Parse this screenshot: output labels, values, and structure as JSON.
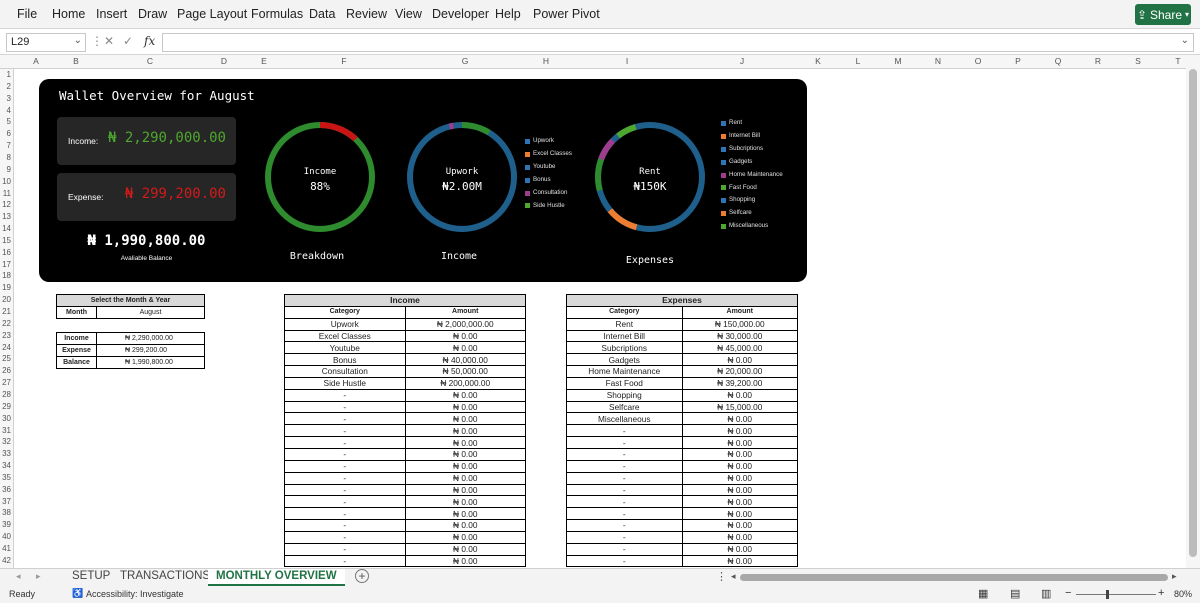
{
  "menu": [
    "File",
    "Home",
    "Insert",
    "Draw",
    "Page Layout",
    "Formulas",
    "Data",
    "Review",
    "View",
    "Developer",
    "Help",
    "Power Pivot"
  ],
  "share_label": "Share",
  "name_box": "L29",
  "fx_label": "fx",
  "columns": [
    "A",
    "B",
    "C",
    "D",
    "E",
    "F",
    "G",
    "H",
    "I",
    "J",
    "K",
    "L",
    "M",
    "N",
    "O",
    "P",
    "Q",
    "R",
    "S",
    "T"
  ],
  "rows": [
    "1",
    "2",
    "3",
    "4",
    "5",
    "6",
    "7",
    "8",
    "9",
    "10",
    "11",
    "12",
    "13",
    "14",
    "15",
    "16",
    "17",
    "18",
    "19",
    "20",
    "21",
    "22",
    "23",
    "24",
    "25",
    "26",
    "27",
    "28",
    "29",
    "30",
    "31",
    "32",
    "33",
    "34",
    "35",
    "36",
    "37",
    "38",
    "39",
    "40",
    "41",
    "42"
  ],
  "dashboard": {
    "title": "Wallet Overview for August",
    "income_label": "Income:",
    "income_value": "₦ 2,290,000.00",
    "expense_label": "Expense:",
    "expense_value": "₦ 299,200.00",
    "balance_value": "₦ 1,990,800.00",
    "balance_label": "Avaliable Balance",
    "ring1": {
      "label": "Income",
      "value": "88%",
      "caption": "Breakdown"
    },
    "ring2": {
      "label": "Upwork",
      "value": "₦2.00M",
      "caption": "Income"
    },
    "ring3": {
      "label": "Rent",
      "value": "₦150K",
      "caption": "Expenses"
    },
    "income_legend": [
      {
        "name": "Upwork",
        "color": "#2e75b6"
      },
      {
        "name": "Excel Classes",
        "color": "#ed7d31"
      },
      {
        "name": "Youtube",
        "color": "#2e75b6"
      },
      {
        "name": "Bonus",
        "color": "#2e75b6"
      },
      {
        "name": "Consultation",
        "color": "#a03c8f"
      },
      {
        "name": "Side Hustle",
        "color": "#4ea72e"
      }
    ],
    "expense_legend": [
      {
        "name": "Rent",
        "color": "#2e75b6"
      },
      {
        "name": "Internet Bill",
        "color": "#ed7d31"
      },
      {
        "name": "Subcriptions",
        "color": "#2e75b6"
      },
      {
        "name": "Gadgets",
        "color": "#2e75b6"
      },
      {
        "name": "Home Maintenance",
        "color": "#a03c8f"
      },
      {
        "name": "Fast Food",
        "color": "#4ea72e"
      },
      {
        "name": "Shopping",
        "color": "#2e75b6"
      },
      {
        "name": "Selfcare",
        "color": "#ed7d31"
      },
      {
        "name": "Miscellaneous",
        "color": "#4ea72e"
      }
    ]
  },
  "selector": {
    "title": "Select the Month & Year",
    "month_label": "Month",
    "month_value": "August",
    "rows": [
      {
        "label": "Income",
        "value": "₦ 2,290,000.00"
      },
      {
        "label": "Expense",
        "value": "₦ 299,200.00"
      },
      {
        "label": "Balance",
        "value": "₦ 1,990,800.00"
      }
    ]
  },
  "income_table": {
    "title": "Income",
    "headers": [
      "Category",
      "Amount"
    ],
    "rows": [
      [
        "Upwork",
        "₦ 2,000,000.00"
      ],
      [
        "Excel Classes",
        "₦ 0.00"
      ],
      [
        "Youtube",
        "₦ 0.00"
      ],
      [
        "Bonus",
        "₦ 40,000.00"
      ],
      [
        "Consultation",
        "₦ 50,000.00"
      ],
      [
        "Side Hustle",
        "₦ 200,000.00"
      ],
      [
        "-",
        "₦ 0.00"
      ],
      [
        "-",
        "₦ 0.00"
      ],
      [
        "-",
        "₦ 0.00"
      ],
      [
        "-",
        "₦ 0.00"
      ],
      [
        "-",
        "₦ 0.00"
      ],
      [
        "-",
        "₦ 0.00"
      ],
      [
        "-",
        "₦ 0.00"
      ],
      [
        "-",
        "₦ 0.00"
      ],
      [
        "-",
        "₦ 0.00"
      ],
      [
        "-",
        "₦ 0.00"
      ],
      [
        "-",
        "₦ 0.00"
      ],
      [
        "-",
        "₦ 0.00"
      ],
      [
        "-",
        "₦ 0.00"
      ],
      [
        "-",
        "₦ 0.00"
      ],
      [
        "-",
        "₦ 0.00"
      ]
    ]
  },
  "expense_table": {
    "title": "Expenses",
    "headers": [
      "Category",
      "Amount"
    ],
    "rows": [
      [
        "Rent",
        "₦ 150,000.00"
      ],
      [
        "Internet Bill",
        "₦ 30,000.00"
      ],
      [
        "Subcriptions",
        "₦ 45,000.00"
      ],
      [
        "Gadgets",
        "₦ 0.00"
      ],
      [
        "Home Maintenance",
        "₦ 20,000.00"
      ],
      [
        "Fast Food",
        "₦ 39,200.00"
      ],
      [
        "Shopping",
        "₦ 0.00"
      ],
      [
        "Selfcare",
        "₦ 15,000.00"
      ],
      [
        "Miscellaneous",
        "₦ 0.00"
      ],
      [
        "-",
        "₦ 0.00"
      ],
      [
        "-",
        "₦ 0.00"
      ],
      [
        "-",
        "₦ 0.00"
      ],
      [
        "-",
        "₦ 0.00"
      ],
      [
        "-",
        "₦ 0.00"
      ],
      [
        "-",
        "₦ 0.00"
      ],
      [
        "-",
        "₦ 0.00"
      ],
      [
        "-",
        "₦ 0.00"
      ],
      [
        "-",
        "₦ 0.00"
      ],
      [
        "-",
        "₦ 0.00"
      ],
      [
        "-",
        "₦ 0.00"
      ],
      [
        "-",
        "₦ 0.00"
      ]
    ]
  },
  "sheet_tabs": [
    "SETUP",
    "TRANSACTIONS",
    "MONTHLY OVERVIEW"
  ],
  "active_tab": "MONTHLY OVERVIEW",
  "status": {
    "ready": "Ready",
    "accessibility": "Accessibility: Investigate",
    "zoom": "80%"
  }
}
